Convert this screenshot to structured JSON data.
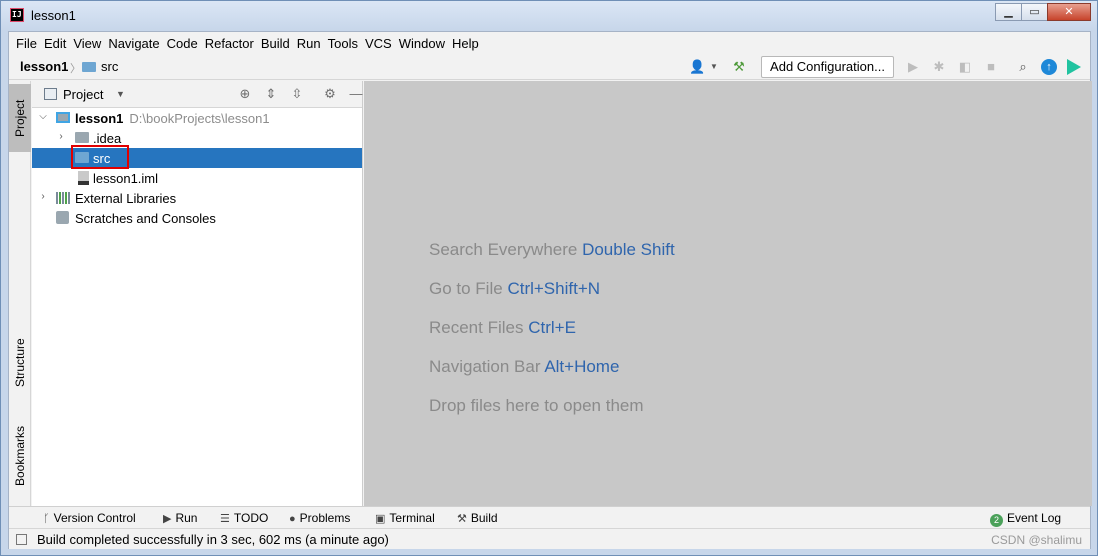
{
  "window": {
    "title": "lesson1",
    "buttons": {
      "minimize": "▁",
      "maximize": "▭",
      "close": "✕"
    }
  },
  "menu": [
    "File",
    "Edit",
    "View",
    "Navigate",
    "Code",
    "Refactor",
    "Build",
    "Run",
    "Tools",
    "VCS",
    "Window",
    "Help"
  ],
  "breadcrumb": {
    "root": "lesson1",
    "child": "src"
  },
  "toolbar": {
    "add_configuration": "Add Configuration..."
  },
  "left_strip": {
    "project": "Project",
    "structure": "Structure",
    "bookmarks": "Bookmarks"
  },
  "project_panel": {
    "title": "Project"
  },
  "tree": {
    "root": {
      "label": "lesson1",
      "path": "D:\\bookProjects\\lesson1"
    },
    "idea": ".idea",
    "src": "src",
    "iml": "lesson1.iml",
    "libraries": "External Libraries",
    "scratches": "Scratches and Consoles"
  },
  "editor_hints": [
    {
      "text": "Search Everywhere",
      "key": "Double Shift"
    },
    {
      "text": "Go to File",
      "key": "Ctrl+Shift+N"
    },
    {
      "text": "Recent Files",
      "key": "Ctrl+E"
    },
    {
      "text": "Navigation Bar",
      "key": "Alt+Home"
    },
    {
      "text": "Drop files here to open them",
      "key": ""
    }
  ],
  "bottom_tools": {
    "version_control": "Version Control",
    "run": "Run",
    "todo": "TODO",
    "problems": "Problems",
    "terminal": "Terminal",
    "build": "Build",
    "event_log": "Event Log",
    "event_count": "2"
  },
  "status": {
    "message": "Build completed successfully in 3 sec, 602 ms (a minute ago)",
    "watermark": "CSDN @shalimu"
  },
  "colors": {
    "selection": "#2675bf",
    "editor_bg": "#c8c8c8",
    "key_blue": "#2f65ad",
    "highlight_box": "#e00000"
  }
}
